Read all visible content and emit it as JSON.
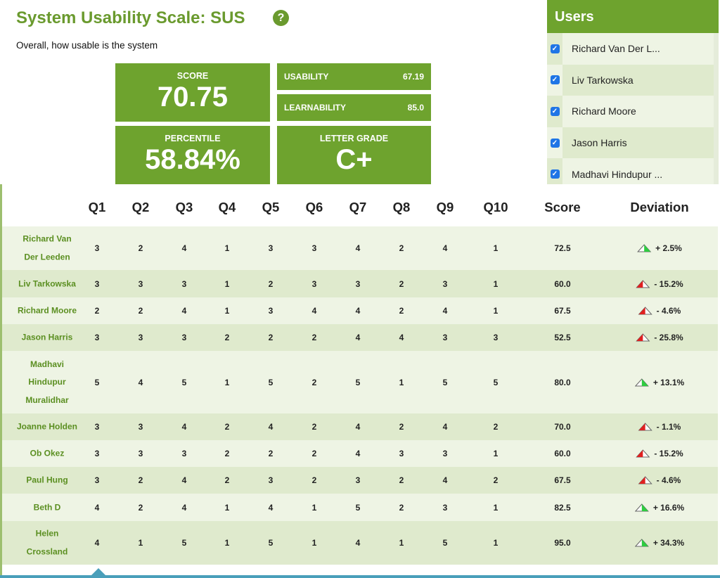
{
  "header": {
    "title": "System Usability Scale: SUS",
    "help_icon": "?",
    "subtitle": "Overall, how usable is the system"
  },
  "summary": {
    "score_label": "SCORE",
    "score_value": "70.75",
    "usability_label": "USABILITY",
    "usability_value": "67.19",
    "learnability_label": "LEARNABILITY",
    "learnability_value": "85.0",
    "percentile_label": "PERCENTILE",
    "percentile_value": "58.84%",
    "grade_label": "LETTER GRADE",
    "grade_value": "C+"
  },
  "users_panel": {
    "title": "Users",
    "items": [
      {
        "label": "Richard Van Der L...",
        "checked": true
      },
      {
        "label": "Liv Tarkowska",
        "checked": true
      },
      {
        "label": "Richard Moore",
        "checked": true
      },
      {
        "label": "Jason Harris",
        "checked": true
      },
      {
        "label": "Madhavi Hindupur ...",
        "checked": true
      }
    ]
  },
  "table": {
    "columns": [
      "Q1",
      "Q2",
      "Q3",
      "Q4",
      "Q5",
      "Q6",
      "Q7",
      "Q8",
      "Q9",
      "Q10",
      "Score",
      "Deviation"
    ],
    "rows": [
      {
        "name": [
          "Richard Van",
          "Der Leeden"
        ],
        "answers": [
          "3",
          "2",
          "4",
          "1",
          "3",
          "3",
          "4",
          "2",
          "4",
          "1"
        ],
        "score": "72.5",
        "deviation": "+ 2.5%",
        "trend": "up"
      },
      {
        "name": [
          "Liv Tarkowska"
        ],
        "answers": [
          "3",
          "3",
          "3",
          "1",
          "2",
          "3",
          "3",
          "2",
          "3",
          "1"
        ],
        "score": "60.0",
        "deviation": "- 15.2%",
        "trend": "down"
      },
      {
        "name": [
          "Richard Moore"
        ],
        "answers": [
          "2",
          "2",
          "4",
          "1",
          "3",
          "4",
          "4",
          "2",
          "4",
          "1"
        ],
        "score": "67.5",
        "deviation": "- 4.6%",
        "trend": "down"
      },
      {
        "name": [
          "Jason Harris"
        ],
        "answers": [
          "3",
          "3",
          "3",
          "2",
          "2",
          "2",
          "4",
          "4",
          "3",
          "3"
        ],
        "score": "52.5",
        "deviation": "- 25.8%",
        "trend": "down"
      },
      {
        "name": [
          "Madhavi",
          "Hindupur",
          "Muralidhar"
        ],
        "answers": [
          "5",
          "4",
          "5",
          "1",
          "5",
          "2",
          "5",
          "1",
          "5",
          "5"
        ],
        "score": "80.0",
        "deviation": "+ 13.1%",
        "trend": "up"
      },
      {
        "name": [
          "Joanne Holden"
        ],
        "answers": [
          "3",
          "3",
          "4",
          "2",
          "4",
          "2",
          "4",
          "2",
          "4",
          "2"
        ],
        "score": "70.0",
        "deviation": "- 1.1%",
        "trend": "down"
      },
      {
        "name": [
          "Ob Okez"
        ],
        "answers": [
          "3",
          "3",
          "3",
          "2",
          "2",
          "2",
          "4",
          "3",
          "3",
          "1"
        ],
        "score": "60.0",
        "deviation": "- 15.2%",
        "trend": "down"
      },
      {
        "name": [
          "Paul Hung"
        ],
        "answers": [
          "3",
          "2",
          "4",
          "2",
          "3",
          "2",
          "3",
          "2",
          "4",
          "2"
        ],
        "score": "67.5",
        "deviation": "- 4.6%",
        "trend": "down"
      },
      {
        "name": [
          "Beth D"
        ],
        "answers": [
          "4",
          "2",
          "4",
          "1",
          "4",
          "1",
          "5",
          "2",
          "3",
          "1"
        ],
        "score": "82.5",
        "deviation": "+ 16.6%",
        "trend": "up"
      },
      {
        "name": [
          "Helen",
          "Crossland"
        ],
        "answers": [
          "4",
          "1",
          "5",
          "1",
          "5",
          "1",
          "4",
          "1",
          "5",
          "1"
        ],
        "score": "95.0",
        "deviation": "+ 34.3%",
        "trend": "up"
      }
    ]
  },
  "colors": {
    "brand_green": "#6ea32e",
    "title_green": "#6a9a2e",
    "row_light": "#eef4e4",
    "row_dark": "#dfeacd",
    "trend_up": "#2ecc40",
    "trend_down": "#e02020",
    "checkbox_blue": "#1f75e6"
  },
  "icons": {
    "help": "help-circle-icon",
    "checkbox": "checkbox-checked-icon",
    "trend_up": "trend-up-triangle-icon",
    "trend_down": "trend-down-triangle-icon"
  }
}
